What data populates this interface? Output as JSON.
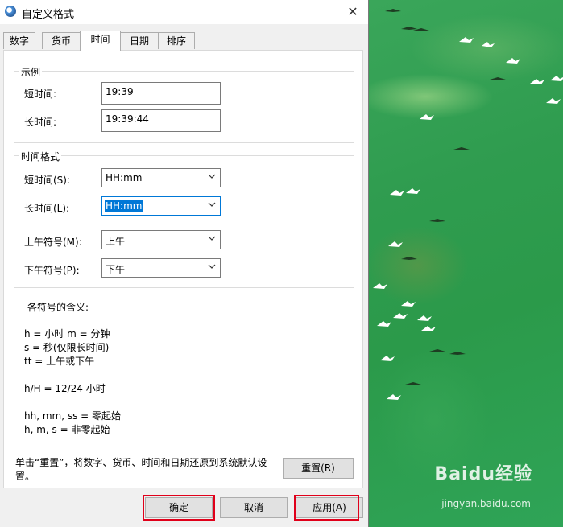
{
  "window": {
    "title": "自定义格式",
    "close_glyph": "✕"
  },
  "tabs": [
    {
      "label": "数字",
      "active": false
    },
    {
      "label": "货币",
      "active": false
    },
    {
      "label": "时间",
      "active": true
    },
    {
      "label": "日期",
      "active": false
    },
    {
      "label": "排序",
      "active": false
    }
  ],
  "example": {
    "group_label": "示例",
    "short_label": "短时间:",
    "short_value": "19:39",
    "long_label": "长时间:",
    "long_value": "19:39:44"
  },
  "format": {
    "group_label": "时间格式",
    "short_label": "短时间(S):",
    "short_value": "HH:mm",
    "long_label": "长时间(L):",
    "long_value": "HH:mm",
    "am_label": "上午符号(M):",
    "am_value": "上午",
    "pm_label": "下午符号(P):",
    "pm_value": "下午"
  },
  "legend": {
    "title": "各符号的含义:",
    "line1": "h = 小时   m = 分钟",
    "line2": "s = 秒(仅限长时间)",
    "line3": "tt = 上午或下午",
    "line4": "h/H = 12/24 小时",
    "line5": "hh, mm, ss = 零起始",
    "line6": "h, m, s = 非零起始"
  },
  "footer": {
    "note": "单击“重置”，将数字、货币、时间和日期还原到系统默认设置。",
    "reset_label": "重置(R)",
    "ok_label": "确定",
    "cancel_label": "取消",
    "apply_label": "应用(A)"
  },
  "watermark": {
    "brand": "Baidu经验",
    "url": "jingyan.baidu.com"
  },
  "colors": {
    "highlight": "#e0001a",
    "selection": "#0078d7",
    "desktop_green": "#2f9c4f"
  }
}
